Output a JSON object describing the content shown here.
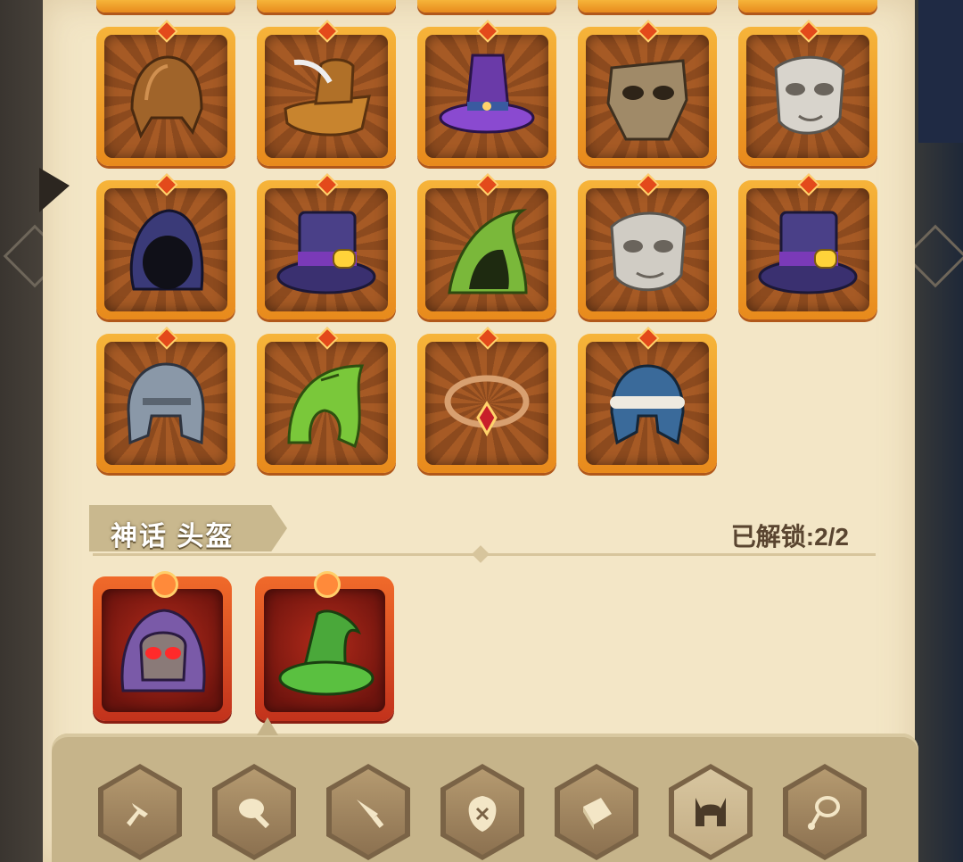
{
  "section": {
    "title": "神话 头盔",
    "unlock_status": "已解锁:2/2"
  },
  "helmets": {
    "row1_names": [
      "leather-cap-icon",
      "feathered-hat-icon",
      "purple-witch-hat-icon",
      "bone-mask-helm-icon",
      "silver-mask-icon"
    ],
    "row2_names": [
      "dark-hood-icon",
      "purple-top-hat-icon",
      "green-hood-icon",
      "silver-face-mask-icon",
      "purple-top-hat-icon"
    ],
    "row3_names": [
      "iron-helmet-icon",
      "green-leaf-hood-icon",
      "ruby-circlet-icon",
      "fur-trim-helmet-icon"
    ]
  },
  "mythic_helmets": [
    "skull-hood-icon",
    "green-wizard-hat-icon"
  ],
  "nav": [
    {
      "name": "sword-tab-icon",
      "active": false
    },
    {
      "name": "meat-tab-icon",
      "active": false
    },
    {
      "name": "dagger-tab-icon",
      "active": false
    },
    {
      "name": "shield-tab-icon",
      "active": false
    },
    {
      "name": "book-tab-icon",
      "active": false
    },
    {
      "name": "helmet-tab-icon",
      "active": true
    },
    {
      "name": "necklace-tab-icon",
      "active": false
    }
  ],
  "colors": {
    "parchment": "#f3e6c6",
    "tile_frame": "#f0a02a",
    "mythic_frame": "#d8462a",
    "text_dark": "#5a4530"
  }
}
